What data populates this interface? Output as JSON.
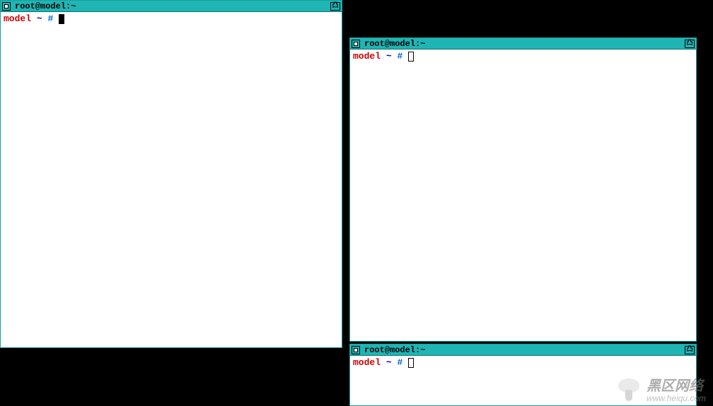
{
  "windows": [
    {
      "id": "win1",
      "title": "root@model:~",
      "prompt": {
        "host": "model",
        "path": "~",
        "symbol": "#"
      },
      "focused": true
    },
    {
      "id": "win2",
      "title": "root@model:~",
      "prompt": {
        "host": "model",
        "path": "~",
        "symbol": "#"
      },
      "focused": false
    },
    {
      "id": "win3",
      "title": "root@model:~",
      "prompt": {
        "host": "model",
        "path": "~",
        "symbol": "#"
      },
      "focused": false
    }
  ],
  "watermark": {
    "text": "黑区网络",
    "url": "www.heiqu.com"
  }
}
